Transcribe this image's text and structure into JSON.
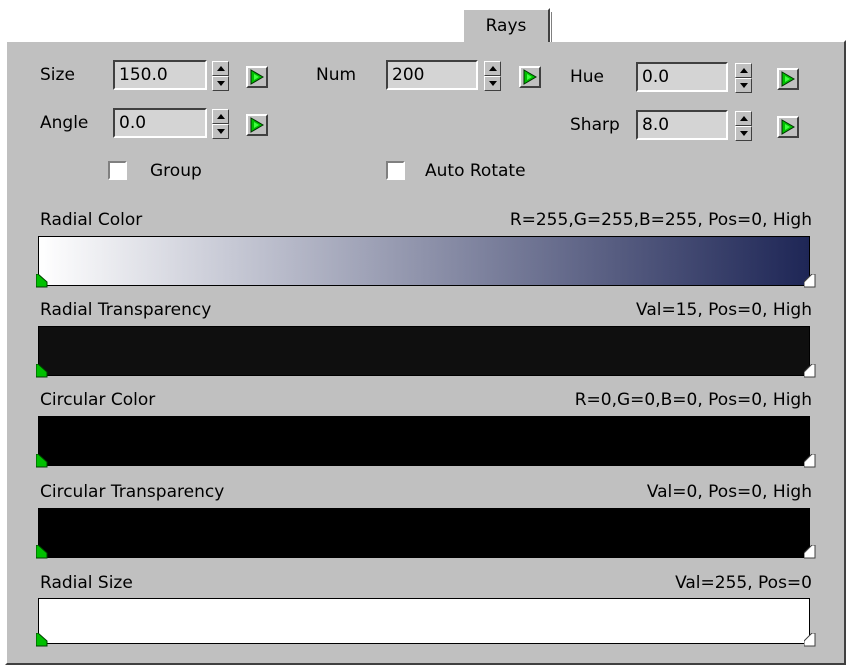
{
  "tab": {
    "label": "Rays"
  },
  "params": {
    "size": {
      "label": "Size",
      "value": "150.0"
    },
    "num": {
      "label": "Num",
      "value": "200"
    },
    "hue": {
      "label": "Hue",
      "value": "0.0"
    },
    "angle": {
      "label": "Angle",
      "value": "0.0"
    },
    "sharp": {
      "label": "Sharp",
      "value": "8.0"
    }
  },
  "checkboxes": {
    "group": {
      "label": "Group",
      "checked": false
    },
    "auto_rotate": {
      "label": "Auto Rotate",
      "checked": false
    }
  },
  "gradients": {
    "radial_color": {
      "label": "Radial Color",
      "info": "R=255,G=255,B=255, Pos=0, High",
      "start_color": "#ffffff",
      "end_color": "#1e2656"
    },
    "radial_transparency": {
      "label": "Radial Transparency",
      "info": "Val=15, Pos=0, High",
      "start_color": "#0f0f0f",
      "end_color": "#0f0f0f"
    },
    "circular_color": {
      "label": "Circular Color",
      "info": "R=0,G=0,B=0, Pos=0, High",
      "start_color": "#000000",
      "end_color": "#000000"
    },
    "circular_transparency": {
      "label": "Circular Transparency",
      "info": "Val=0, Pos=0, High",
      "start_color": "#000000",
      "end_color": "#000000"
    },
    "radial_size": {
      "label": "Radial Size",
      "info": "Val=255, Pos=0",
      "start_color": "#ffffff",
      "end_color": "#ffffff"
    }
  },
  "colors": {
    "panel_bg": "#c0c0c0",
    "key_green": "#00c000",
    "marker_green": "#00c000",
    "marker_white": "#ffffff"
  },
  "icons": {
    "key_button": "animation-key-icon",
    "spinner": "spinner-icon",
    "start_marker": "gradient-flag-start-icon",
    "end_marker": "gradient-flag-end-icon"
  }
}
